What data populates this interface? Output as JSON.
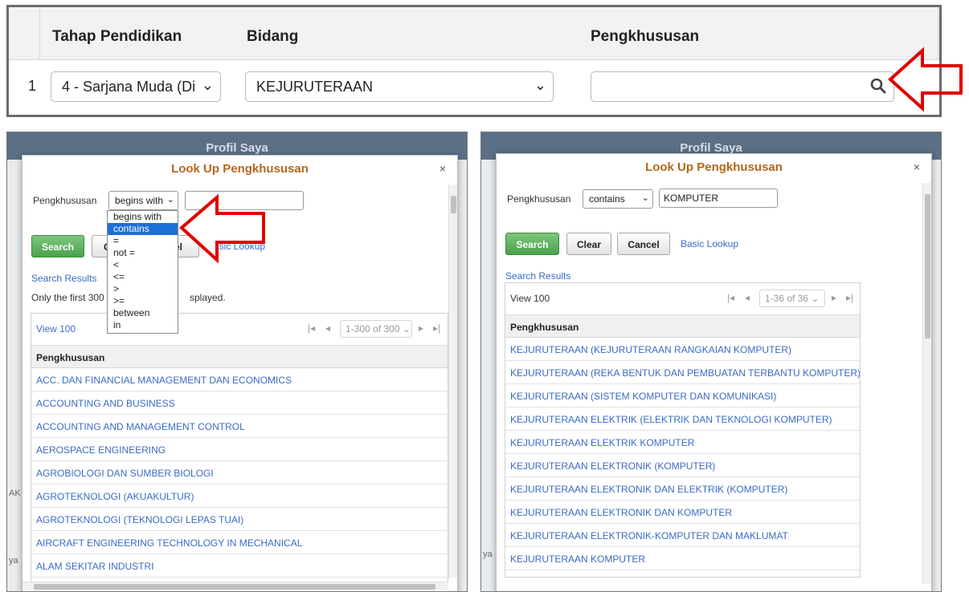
{
  "grid": {
    "headers": [
      "Tahap Pendidikan",
      "Bidang",
      "Pengkhususan"
    ],
    "row_number": "1",
    "tahap_value": "4 - Sarjana Muda (Di",
    "bidang_value": "KEJURUTERAAN",
    "pengkhususan_value": ""
  },
  "left_panel": {
    "background_title": "Profil Saya",
    "side_text_1": "AK",
    "side_text_2": "ya",
    "dialog_title": "Look Up Pengkhususan",
    "close": "×",
    "field_label": "Pengkhususan",
    "operator_value": "begins with",
    "search_value": "",
    "buttons": {
      "search": "Search",
      "clear": "C",
      "cancel": "el",
      "basic_lookup": "Basic Lookup"
    },
    "search_results_label": "Search Results",
    "note_left": "Only the first 300 r",
    "note_right": "splayed.",
    "view_all": "View 100",
    "range": "1-300 of 300",
    "column_header": "Pengkhususan",
    "rows": [
      "ACC. DAN FINANCIAL MANAGEMENT DAN ECONOMICS",
      "ACCOUNTING AND BUSINESS",
      "ACCOUNTING AND MANAGEMENT CONTROL",
      "AEROSPACE ENGINEERING",
      "AGROBIOLOGI DAN SUMBER BIOLOGI",
      "AGROTEKNOLOGI (AKUAKULTUR)",
      "AGROTEKNOLOGI (TEKNOLOGI LEPAS TUAI)",
      "AIRCRAFT ENGINEERING TECHNOLOGY IN MECHANICAL",
      "ALAM SEKITAR INDUSTRI"
    ],
    "operator_options": [
      "begins with",
      "contains",
      "=",
      "not =",
      "<",
      "<=",
      ">",
      ">=",
      "between",
      "in"
    ],
    "highlighted_option": "contains"
  },
  "right_panel": {
    "background_title": "Profil Saya",
    "side_text": "ya",
    "dialog_title": "Look Up Pengkhususan",
    "close": "×",
    "field_label": "Pengkhususan",
    "operator_value": "contains",
    "search_value": "KOMPUTER",
    "buttons": {
      "search": "Search",
      "clear": "Clear",
      "cancel": "Cancel",
      "basic_lookup": "Basic Lookup"
    },
    "search_results_label": "Search Results",
    "view_all": "View 100",
    "range": "1-36 of 36",
    "column_header": "Pengkhususan",
    "rows": [
      "KEJURUTERAAN (KEJURUTERAAN RANGKAIAN KOMPUTER)",
      "KEJURUTERAAN (REKA BENTUK DAN PEMBUATAN TERBANTU KOMPUTER)",
      "KEJURUTERAAN (SISTEM KOMPUTER DAN KOMUNIKASI)",
      "KEJURUTERAAN ELEKTRIK (ELEKTRIK DAN TEKNOLOGI KOMPUTER)",
      "KEJURUTERAAN ELEKTRIK KOMPUTER",
      "KEJURUTERAAN ELEKTRONIK (KOMPUTER)",
      "KEJURUTERAAN ELEKTRONIK DAN ELEKTRIK (KOMPUTER)",
      "KEJURUTERAAN ELEKTRONIK DAN KOMPUTER",
      "KEJURUTERAAN ELEKTRONIK-KOMPUTER DAN MAKLUMAT",
      "KEJURUTERAAN KOMPUTER"
    ]
  },
  "colors": {
    "title_orange": "#b5651d",
    "link_blue": "#3b6bc4",
    "search_green": "#4aa14c",
    "arrow_red": "#e00000",
    "highlight_blue": "#1e6ed8"
  }
}
